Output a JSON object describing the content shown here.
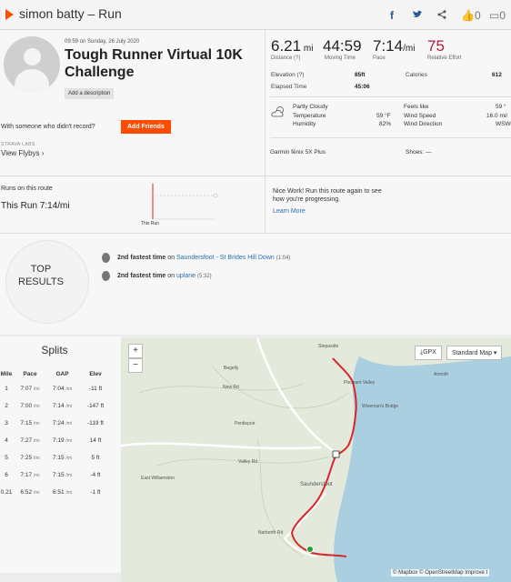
{
  "header": {
    "breadcrumb": "simon batty – Run",
    "facebook_icon": "f",
    "twitter_icon": "t",
    "kudos_count": "0",
    "comment_count": "0"
  },
  "activity": {
    "date": "09:59 on Sunday, 26 July 2020",
    "title": "Tough Runner Virtual 10K Challenge",
    "add_description": "Add a description",
    "with_someone": "With someone who didn't record?",
    "add_friends": "Add Friends",
    "strava_labs": "STRAVA LABS",
    "view_flybys": "View Flybys ›"
  },
  "stats": {
    "distance": "6.21",
    "distance_unit": "mi",
    "distance_label": "Distance (?)",
    "moving_time": "44:59",
    "moving_time_label": "Moving Time",
    "pace": "7:14",
    "pace_unit": "/mi",
    "pace_label": "Pace",
    "effort": "75",
    "effort_label": "Relative Effort",
    "elevation_label": "Elevation (?)",
    "elevation_value": "85ft",
    "calories_label": "Calories",
    "calories_value": "612",
    "elapsed_label": "Elapsed Time",
    "elapsed_value": "45:06"
  },
  "weather": {
    "condition": "Partly Cloudy",
    "temperature_label": "Temperature",
    "temperature_value": "59 °F",
    "humidity_label": "Humidity",
    "humidity_value": "82%",
    "feels_like_label": "Feels like",
    "feels_like_value": "59 °",
    "wind_speed_label": "Wind Speed",
    "wind_speed_value": "16.0 mi/",
    "wind_direction_label": "Wind Direction",
    "wind_direction_value": "WSW"
  },
  "gear": {
    "device": "Garmin fēnix 5X Plus",
    "shoes": "Shoes: —"
  },
  "route": {
    "runs_label": "Runs on this route",
    "this_run": "This Run 7:14/mi",
    "chart_label": "This Run",
    "nice_work": "Nice Work! Run this route again to see how you're progressing.",
    "learn_more": "Learn More"
  },
  "top_results": {
    "title_line1": "TOP",
    "title_line2": "RESULTS",
    "items": [
      {
        "rank": "2nd fastest time",
        "on": "on",
        "segment": "Saundersfoot - St Brides Hill Down",
        "time": "(1:04)"
      },
      {
        "rank": "2nd fastest time",
        "on": "on",
        "segment": "uplane",
        "time": "(5:32)"
      }
    ]
  },
  "splits": {
    "title": "Splits",
    "headers": [
      "Mile",
      "Pace",
      "GAP",
      "Elev"
    ],
    "unit": "/mi",
    "rows": [
      {
        "mile": "1",
        "pace": "7:07",
        "gap": "7:04",
        "elev": "-11 ft"
      },
      {
        "mile": "2",
        "pace": "7:00",
        "gap": "7:14",
        "elev": "-147 ft"
      },
      {
        "mile": "3",
        "pace": "7:15",
        "gap": "7:24",
        "elev": "-119 ft"
      },
      {
        "mile": "4",
        "pace": "7:27",
        "gap": "7:19",
        "elev": "14 ft"
      },
      {
        "mile": "5",
        "pace": "7:25",
        "gap": "7:15",
        "elev": "5 ft"
      },
      {
        "mile": "6",
        "pace": "7:17",
        "gap": "7:15",
        "elev": "-4 ft"
      },
      {
        "mile": "0.21",
        "pace": "6:52",
        "gap": "6:51",
        "elev": "-1 ft"
      }
    ]
  },
  "map": {
    "zoom_in": "+",
    "zoom_out": "−",
    "gpx": "GPX",
    "map_style": "Standard Map ▾",
    "places": [
      "Stepaside",
      "Begelly",
      "Amroth",
      "Pleasant Valley",
      "Wiseman's Bridge",
      "Pentlepoir",
      "Valley Rd",
      "East Williamston",
      "Saundersfoot",
      "Narberth Rd",
      "New Rd"
    ],
    "attribution": "© Mapbox © OpenStreetMap Improve t"
  },
  "colors": {
    "brand": "#fc4c02",
    "effort": "#b01c3d",
    "route": "#d7262c",
    "sea": "#a9cfe0",
    "land": "#e3eadb"
  }
}
